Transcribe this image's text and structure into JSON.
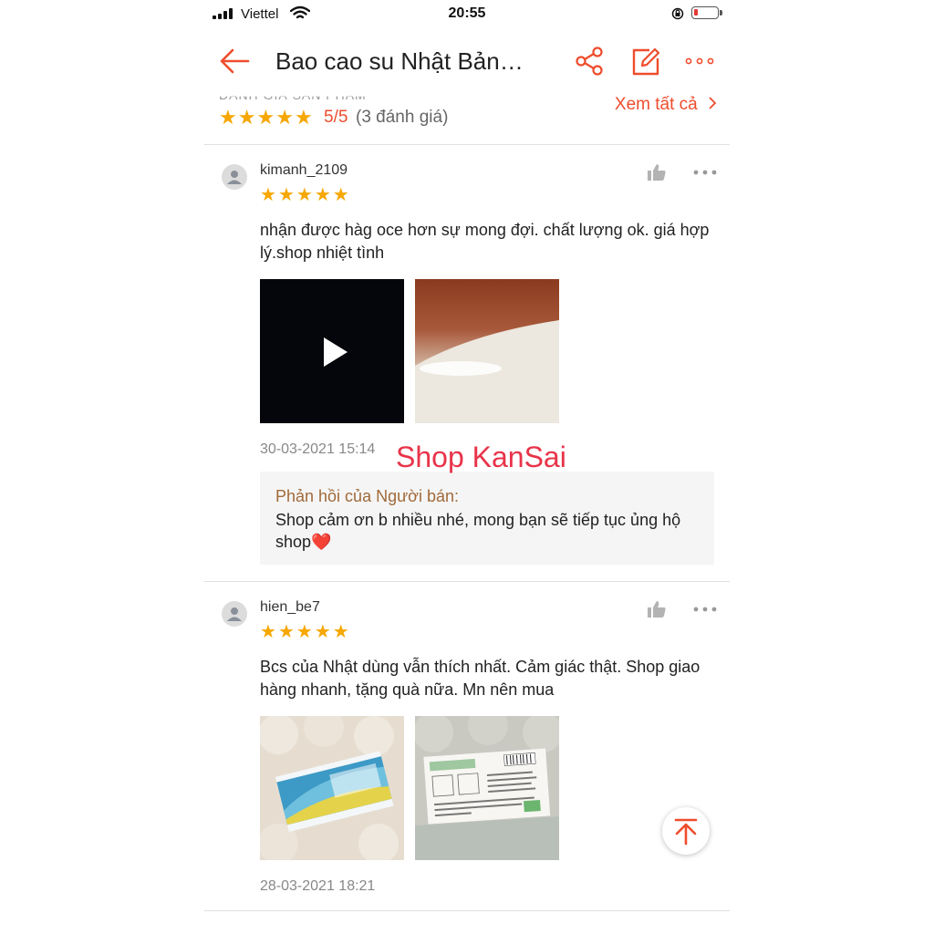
{
  "status_bar": {
    "carrier": "Viettel",
    "time": "20:55"
  },
  "header": {
    "title": "Bao cao su Nhật Bản…"
  },
  "summary": {
    "heading": "ĐÁNH GIÁ SẢN PHẨM",
    "stars": 5,
    "score": "5/5",
    "count": "(3 đánh giá)",
    "see_all": "Xem tất cả"
  },
  "reviews": [
    {
      "username": "kimanh_2109",
      "stars": 5,
      "text": "nhận được hàg oce hơn sự mong đợi. chất lượng ok. giá hợp lý.shop nhiệt tình",
      "date": "30-03-2021 15:14",
      "media": [
        "video-thumbnail",
        "photo"
      ],
      "seller_reply": {
        "label": "Phản hồi của Người bán:",
        "text": "Shop cảm ơn b nhiều nhé, mong bạn sẽ tiếp tục ủng hộ shop❤️"
      }
    },
    {
      "username": "hien_be7",
      "stars": 5,
      "text": "Bcs của Nhật dùng vẫn thích nhất. Cảm giác thật. Shop giao hàng nhanh, tặng quà nữa. Mn nên mua",
      "date": "28-03-2021 18:21",
      "media": [
        "photo-box-front",
        "photo-box-back"
      ]
    }
  ],
  "watermark": "Shop KanSai",
  "colors": {
    "accent": "#ee4d2d",
    "star": "#f6a700",
    "reply_label": "#a06a3a",
    "watermark": "#e8344a"
  },
  "icons": [
    "back-arrow-icon",
    "share-icon",
    "edit-icon",
    "more-icon",
    "like-icon",
    "play-icon",
    "scroll-to-top-icon",
    "wifi-icon",
    "battery-icon"
  ]
}
